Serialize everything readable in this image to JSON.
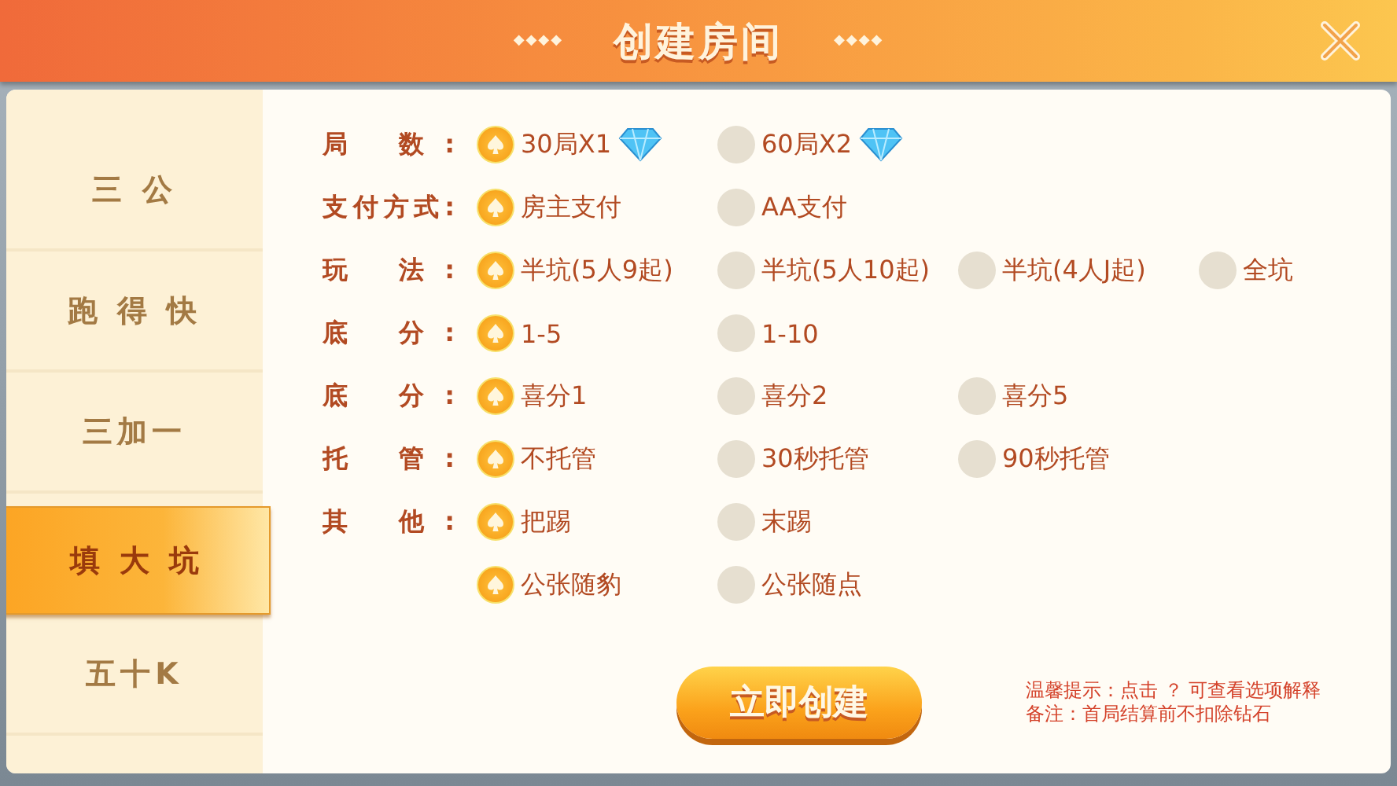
{
  "header": {
    "title": "创建房间",
    "ornament_left": "◆◆◆◆",
    "ornament_right": "◆◆◆◆"
  },
  "sidebar": {
    "items": [
      {
        "label": "三 公",
        "selected": false
      },
      {
        "label": "跑 得 快",
        "selected": false
      },
      {
        "label": "三加一",
        "selected": false
      },
      {
        "label": "填 大 坑",
        "selected": true
      },
      {
        "label": "五十K",
        "selected": false
      }
    ]
  },
  "settings": [
    {
      "label": "局 数:",
      "options": [
        {
          "text": "30局X1",
          "selected": true,
          "diamond": true
        },
        {
          "text": "60局X2",
          "selected": false,
          "diamond": true
        }
      ]
    },
    {
      "label": "支付方式:",
      "options": [
        {
          "text": "房主支付",
          "selected": true,
          "diamond": false
        },
        {
          "text": "AA支付",
          "selected": false,
          "diamond": false
        }
      ]
    },
    {
      "label": "玩 法:",
      "options": [
        {
          "text": "半坑(5人9起)",
          "selected": true,
          "diamond": false
        },
        {
          "text": "半坑(5人10起)",
          "selected": false,
          "diamond": false
        },
        {
          "text": "半坑(4人J起)",
          "selected": false,
          "diamond": false
        },
        {
          "text": "全坑",
          "selected": false,
          "diamond": false
        }
      ]
    },
    {
      "label": "底 分:",
      "options": [
        {
          "text": "1-5",
          "selected": true,
          "diamond": false
        },
        {
          "text": "1-10",
          "selected": false,
          "diamond": false
        }
      ]
    },
    {
      "label": "底 分:",
      "options": [
        {
          "text": "喜分1",
          "selected": true,
          "diamond": false
        },
        {
          "text": "喜分2",
          "selected": false,
          "diamond": false
        },
        {
          "text": "喜分5",
          "selected": false,
          "diamond": false
        }
      ]
    },
    {
      "label": "托 管:",
      "options": [
        {
          "text": "不托管",
          "selected": true,
          "diamond": false
        },
        {
          "text": "30秒托管",
          "selected": false,
          "diamond": false
        },
        {
          "text": "90秒托管",
          "selected": false,
          "diamond": false
        }
      ]
    },
    {
      "label": "其 他:",
      "options": [
        {
          "text": "把踢",
          "selected": true,
          "diamond": false
        },
        {
          "text": "末踢",
          "selected": false,
          "diamond": false
        }
      ]
    },
    {
      "options": [
        {
          "text": "公张随豹",
          "selected": true,
          "diamond": false
        },
        {
          "text": "公张随点",
          "selected": false,
          "diamond": false
        }
      ]
    }
  ],
  "create_button": "立即创建",
  "tips": [
    "温馨提示：点击 ？ 可查看选项解释",
    "备注：首局结算前不扣除钻石"
  ]
}
